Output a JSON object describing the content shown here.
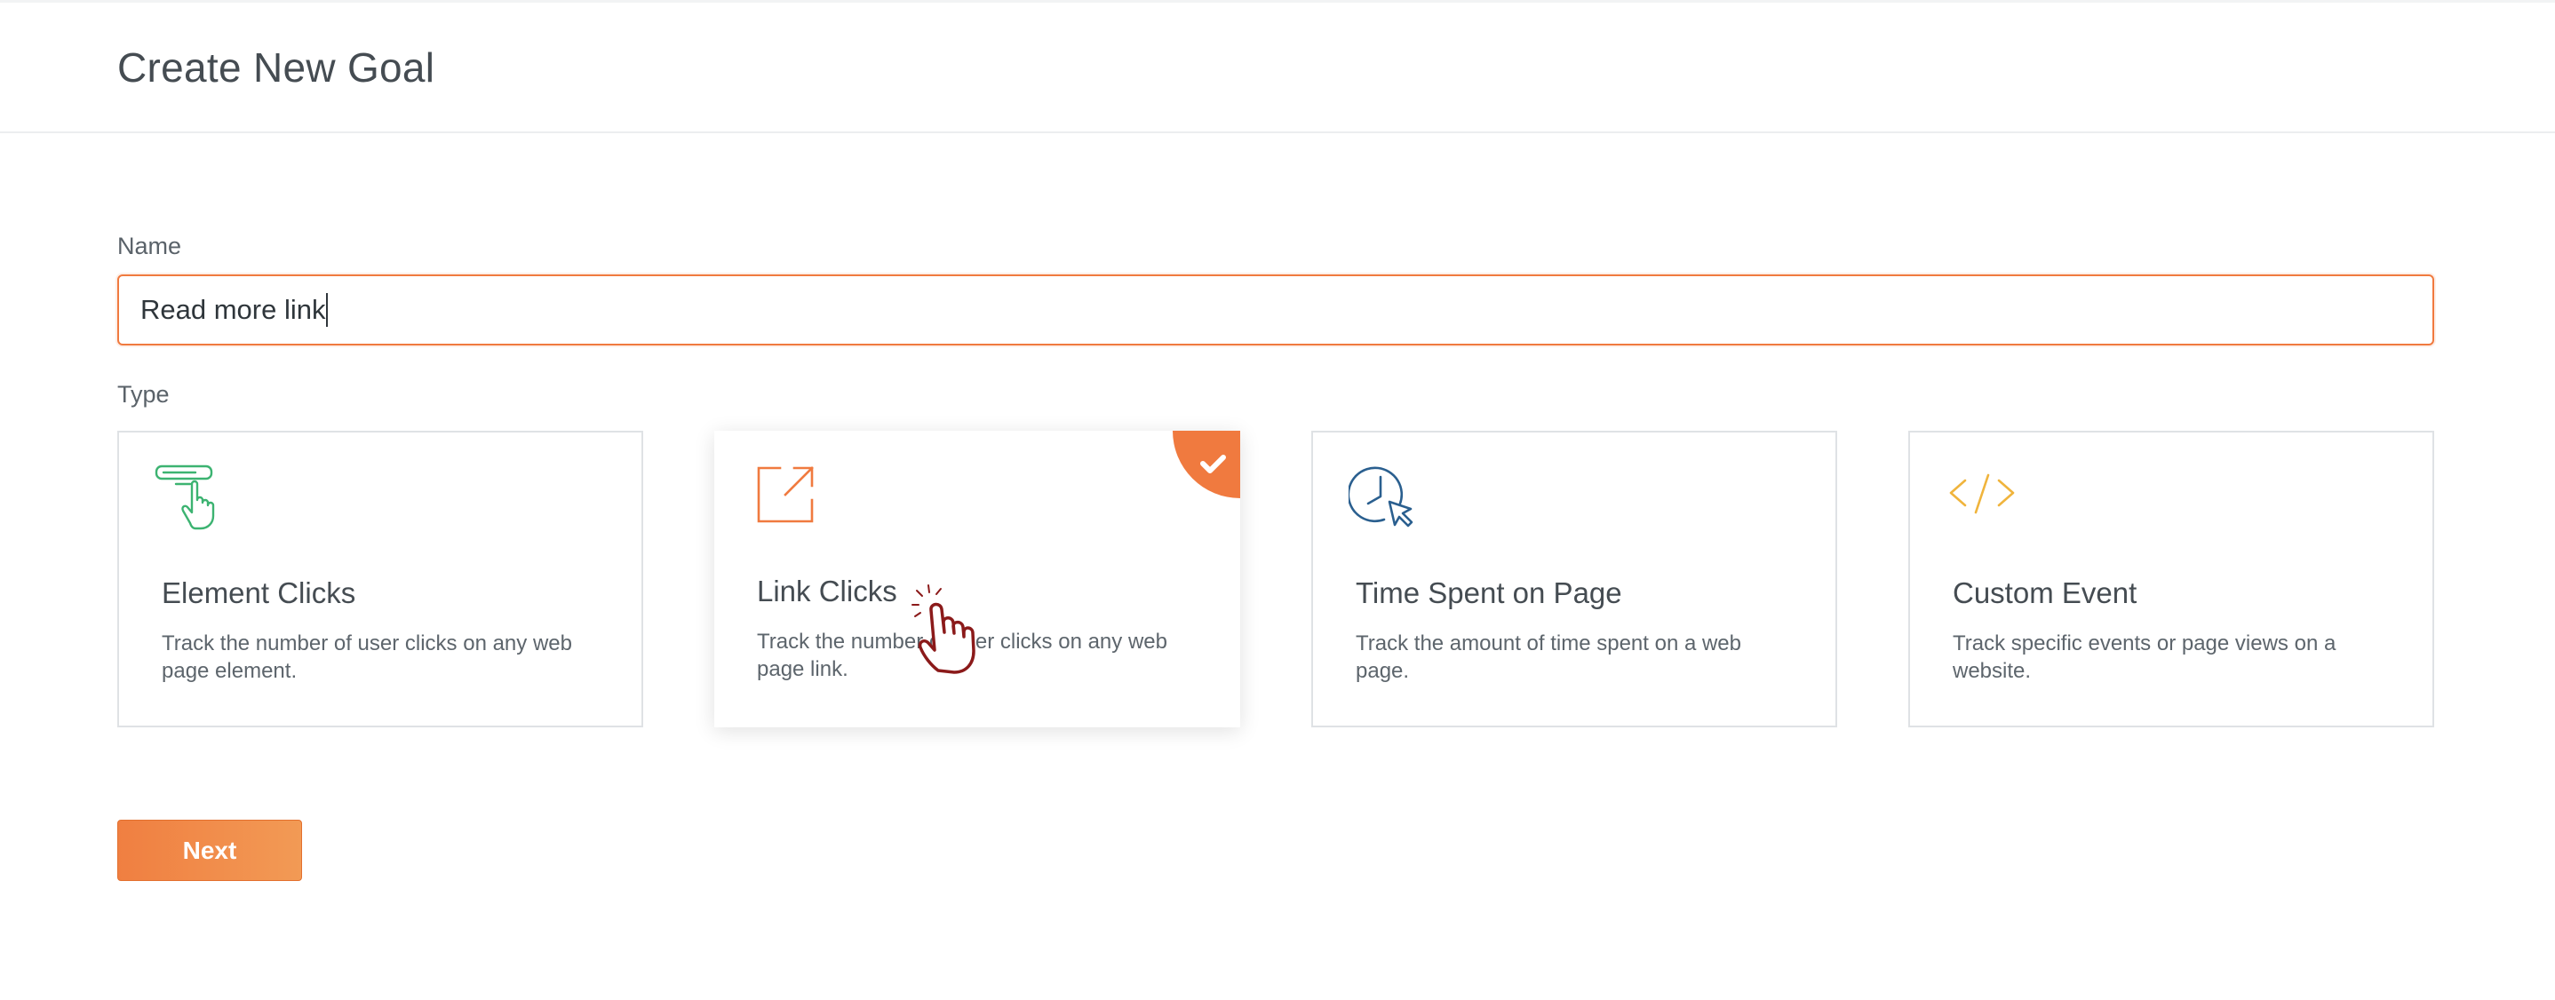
{
  "header": {
    "title": "Create New Goal"
  },
  "form": {
    "name_label": "Name",
    "name_value": "Read more link",
    "type_label": "Type"
  },
  "types": [
    {
      "title": "Element Clicks",
      "description": "Track the number of user clicks on any web page element.",
      "icon": "element-click-icon",
      "icon_color": "#3cb371",
      "selected": false
    },
    {
      "title": "Link Clicks",
      "description": "Track the number of user clicks on any web page link.",
      "icon": "external-link-icon",
      "icon_color": "#f07a3f",
      "selected": true
    },
    {
      "title": "Time Spent on Page",
      "description": "Track the amount of time spent on a web page.",
      "icon": "clock-cursor-icon",
      "icon_color": "#2a5f8f",
      "selected": false
    },
    {
      "title": "Custom Event",
      "description": "Track specific events or page views on a website.",
      "icon": "code-icon",
      "icon_color": "#f0b43c",
      "selected": false
    }
  ],
  "actions": {
    "next_label": "Next"
  },
  "colors": {
    "accent": "#f07a3f",
    "selected_check": "#f07a3f",
    "cursor_outline": "#8b1a1a"
  }
}
